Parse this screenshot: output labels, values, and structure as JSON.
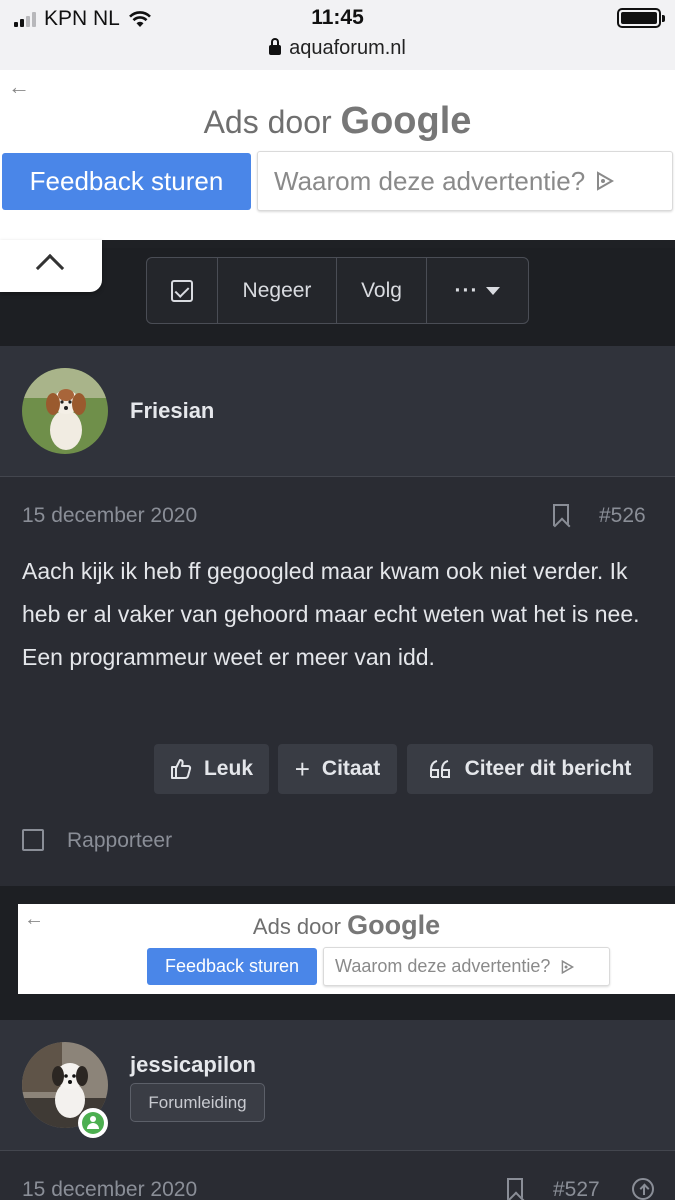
{
  "status_bar": {
    "carrier": "KPN NL",
    "time": "11:45",
    "url": "aquaforum.nl"
  },
  "ad_top": {
    "title_prefix": "Ads door",
    "title_brand": "Google",
    "feedback_label": "Feedback sturen",
    "why_label": "Waarom deze advertentie?"
  },
  "thread_toolbar": {
    "ignore_label": "Negeer",
    "follow_label": "Volg",
    "more_label": "···"
  },
  "posts": [
    {
      "username": "Friesian",
      "date": "15 december 2020",
      "number": "#526",
      "body": "Aach kijk ik heb ff gegoogled maar kwam ook niet verder. Ik heb er al vaker van gehoord maar echt weten wat het is nee. Een programmeur weet er meer van idd.",
      "like_label": "Leuk",
      "quote_label": "Citaat",
      "reply_quote_label": "Citeer dit bericht",
      "report_label": "Rapporteer"
    },
    {
      "username": "jessicapilon",
      "badge": "Forumleiding",
      "date": "15 december 2020",
      "number": "#527"
    }
  ],
  "ad_mid": {
    "title_prefix": "Ads door",
    "title_brand": "Google",
    "feedback_label": "Feedback sturen",
    "why_label": "Waarom deze advertentie?"
  }
}
